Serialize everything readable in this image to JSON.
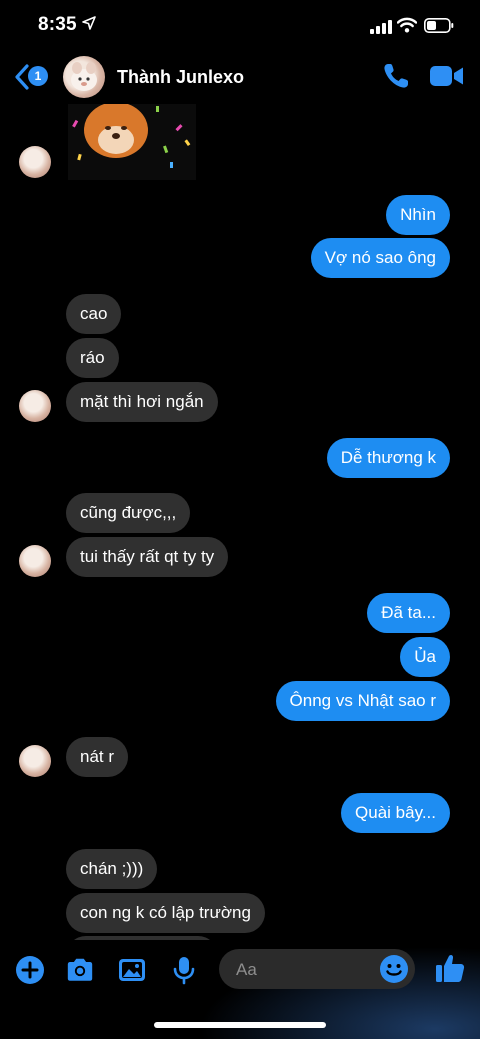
{
  "status_bar": {
    "time": "8:35"
  },
  "header": {
    "unread_count": "1",
    "contact_name": "Thành Junlexo"
  },
  "messages": [
    {
      "dir": "out",
      "text": "Nhìn"
    },
    {
      "dir": "out",
      "text": "Vợ nó sao ông"
    },
    {
      "dir": "in",
      "text": "cao"
    },
    {
      "dir": "in",
      "text": "ráo"
    },
    {
      "dir": "in",
      "text": "mặt thì hơi ngắn"
    },
    {
      "dir": "out",
      "text": "Dễ thương k"
    },
    {
      "dir": "in",
      "text": "cũng được,,,"
    },
    {
      "dir": "in",
      "text": "tui thấy rất qt ty ty"
    },
    {
      "dir": "out",
      "text": "Đã ta..."
    },
    {
      "dir": "out",
      "text": "Ủa"
    },
    {
      "dir": "out",
      "text": "Ônng vs Nhật sao r"
    },
    {
      "dir": "in",
      "text": "nát r"
    },
    {
      "dir": "out",
      "text": "Quài bây..."
    },
    {
      "dir": "in",
      "text": "chán ;)))"
    },
    {
      "dir": "in",
      "text": "con ng k có lập trường"
    }
  ],
  "composer": {
    "placeholder": "Aa"
  },
  "colors": {
    "accent": "#1e8df2",
    "incoming_bubble": "#303030",
    "background": "#000000"
  }
}
